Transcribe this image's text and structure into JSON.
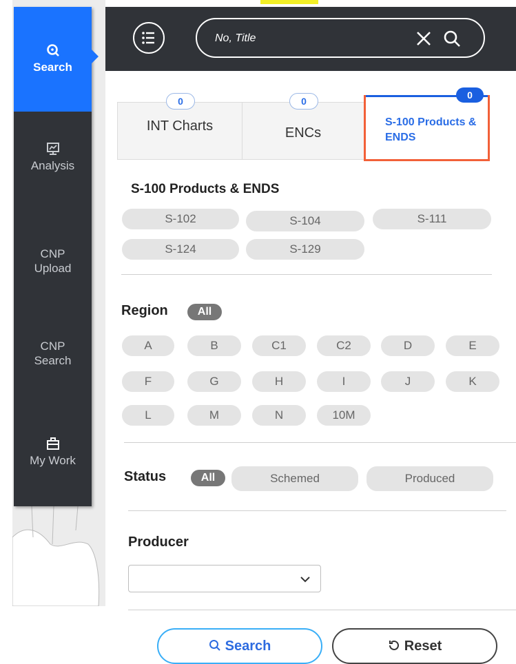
{
  "sidebar": {
    "items": [
      {
        "label": "Search",
        "icon": "search-icon",
        "active": true
      },
      {
        "label": "Analysis",
        "icon": "presentation-chart-icon"
      },
      {
        "label": "CNP Upload"
      },
      {
        "label": "CNP Search"
      },
      {
        "label": "My Work",
        "icon": "briefcase-icon"
      }
    ]
  },
  "header": {
    "search_placeholder": "No, Title"
  },
  "tabs": [
    {
      "label": "INT Charts",
      "count": "0"
    },
    {
      "label": "ENCs",
      "count": "0"
    },
    {
      "label": "S-100 Products & ENDS",
      "count": "0",
      "active": true
    }
  ],
  "products": {
    "title": "S-100 Products & ENDS",
    "items": [
      "S-102",
      "S-104",
      "S-111",
      "S-124",
      "S-129"
    ]
  },
  "region": {
    "title": "Region",
    "all_label": "All",
    "items": [
      "A",
      "B",
      "C1",
      "C2",
      "D",
      "E",
      "F",
      "G",
      "H",
      "I",
      "J",
      "K",
      "L",
      "M",
      "N",
      "10M"
    ]
  },
  "status": {
    "title": "Status",
    "all_label": "All",
    "items": [
      "Schemed",
      "Produced"
    ]
  },
  "producer": {
    "title": "Producer",
    "selected": ""
  },
  "actions": {
    "search_label": "Search",
    "reset_label": "Reset"
  },
  "colors": {
    "accent": "#1a73ff",
    "highlight_border": "#f26038",
    "sidebar_bg": "#303338"
  }
}
